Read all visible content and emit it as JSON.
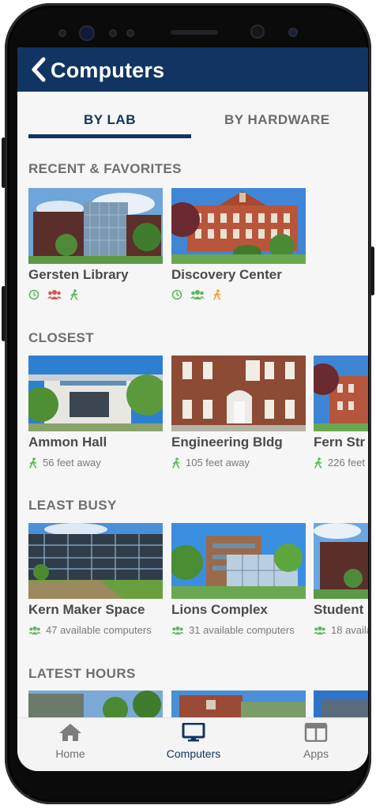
{
  "header": {
    "title": "Computers"
  },
  "tabs": [
    {
      "label": "BY LAB",
      "active": true
    },
    {
      "label": "BY HARDWARE",
      "active": false
    }
  ],
  "sections": {
    "recent": {
      "title": "RECENT & FAVORITES",
      "cards": [
        {
          "name": "Gersten Library",
          "icons": [
            "clock-icon",
            "group-icon",
            "walk-icon"
          ]
        },
        {
          "name": "Discovery Center",
          "icons": [
            "clock-icon",
            "group-icon",
            "walk-icon"
          ]
        }
      ]
    },
    "closest": {
      "title": "CLOSEST",
      "cards": [
        {
          "name": "Ammon Hall",
          "meta": "56 feet away"
        },
        {
          "name": "Engineering Bldg",
          "meta": "105 feet away"
        },
        {
          "name": "Fern Str",
          "meta": "226 feet"
        }
      ]
    },
    "least_busy": {
      "title": "LEAST BUSY",
      "cards": [
        {
          "name": "Kern Maker Space",
          "meta": "47 available computers"
        },
        {
          "name": "Lions Complex",
          "meta": "31 available computers"
        },
        {
          "name": "Student",
          "meta": "18 availa"
        }
      ]
    },
    "latest_hours": {
      "title": "LATEST HOURS"
    }
  },
  "nav": [
    {
      "label": "Home",
      "icon": "home-icon"
    },
    {
      "label": "Computers",
      "icon": "monitor-icon",
      "active": true
    },
    {
      "label": "Apps",
      "icon": "apps-icon"
    }
  ],
  "colors": {
    "primary": "#123462",
    "status_green": "#5cb85c",
    "status_red": "#d9534f",
    "status_orange": "#f0a030",
    "text_muted": "#7a7a7a"
  }
}
